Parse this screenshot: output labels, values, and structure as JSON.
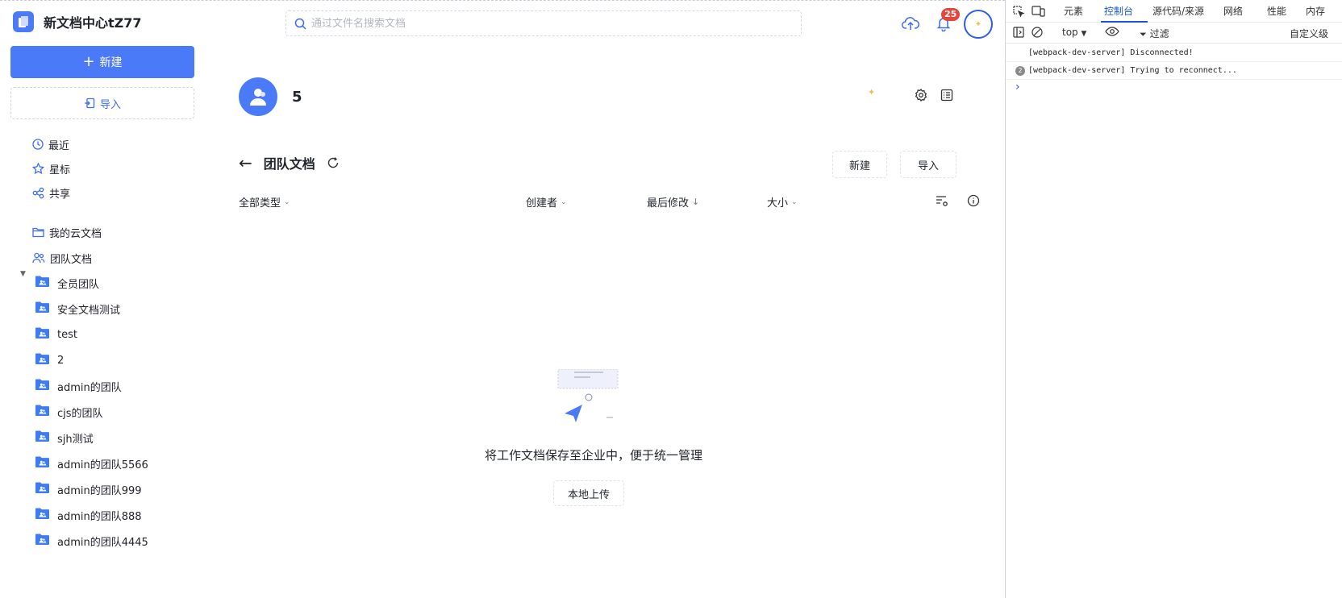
{
  "brand": {
    "title": "新文档中心tZ77"
  },
  "sidebar": {
    "new_label": "新建",
    "import_label": "导入",
    "nav": [
      {
        "label": "最近",
        "icon": "clock-icon"
      },
      {
        "label": "星标",
        "icon": "star-icon"
      },
      {
        "label": "共享",
        "icon": "share-icon"
      }
    ],
    "my_docs": "我的云文档",
    "team_docs": "团队文档",
    "teams": [
      "全员团队",
      "安全文档测试",
      "test",
      "2",
      "admin的团队",
      "cjs的团队",
      "sjh测试",
      "admin的团队5566",
      "admin的团队999",
      "admin的团队888",
      "admin的团队4445"
    ]
  },
  "header": {
    "search_placeholder": "通过文件名搜索文档",
    "notification_count": "25"
  },
  "team": {
    "name": "5"
  },
  "folder": {
    "title": "团队文档",
    "new_label": "新建",
    "import_label": "导入"
  },
  "columns": {
    "type": "全部类型",
    "creator": "创建者",
    "modified": "最后修改",
    "size": "大小"
  },
  "empty": {
    "message": "将工作文档保存至企业中，便于统一管理",
    "upload_label": "本地上传"
  },
  "devtools": {
    "tabs": [
      "元素",
      "控制台",
      "源代码/来源",
      "网络",
      "性能",
      "内存"
    ],
    "active_tab": "控制台",
    "context": "top",
    "filter_label": "过滤",
    "custom_levels": "自定义级",
    "messages": [
      {
        "text": "[webpack-dev-server] Disconnected!",
        "count": ""
      },
      {
        "text": "[webpack-dev-server] Trying to reconnect...",
        "count": "2"
      }
    ],
    "prompt": "›"
  },
  "colors": {
    "accent": "#4a7af7",
    "badge": "#e8443a",
    "devtools_active": "#1a56db"
  }
}
